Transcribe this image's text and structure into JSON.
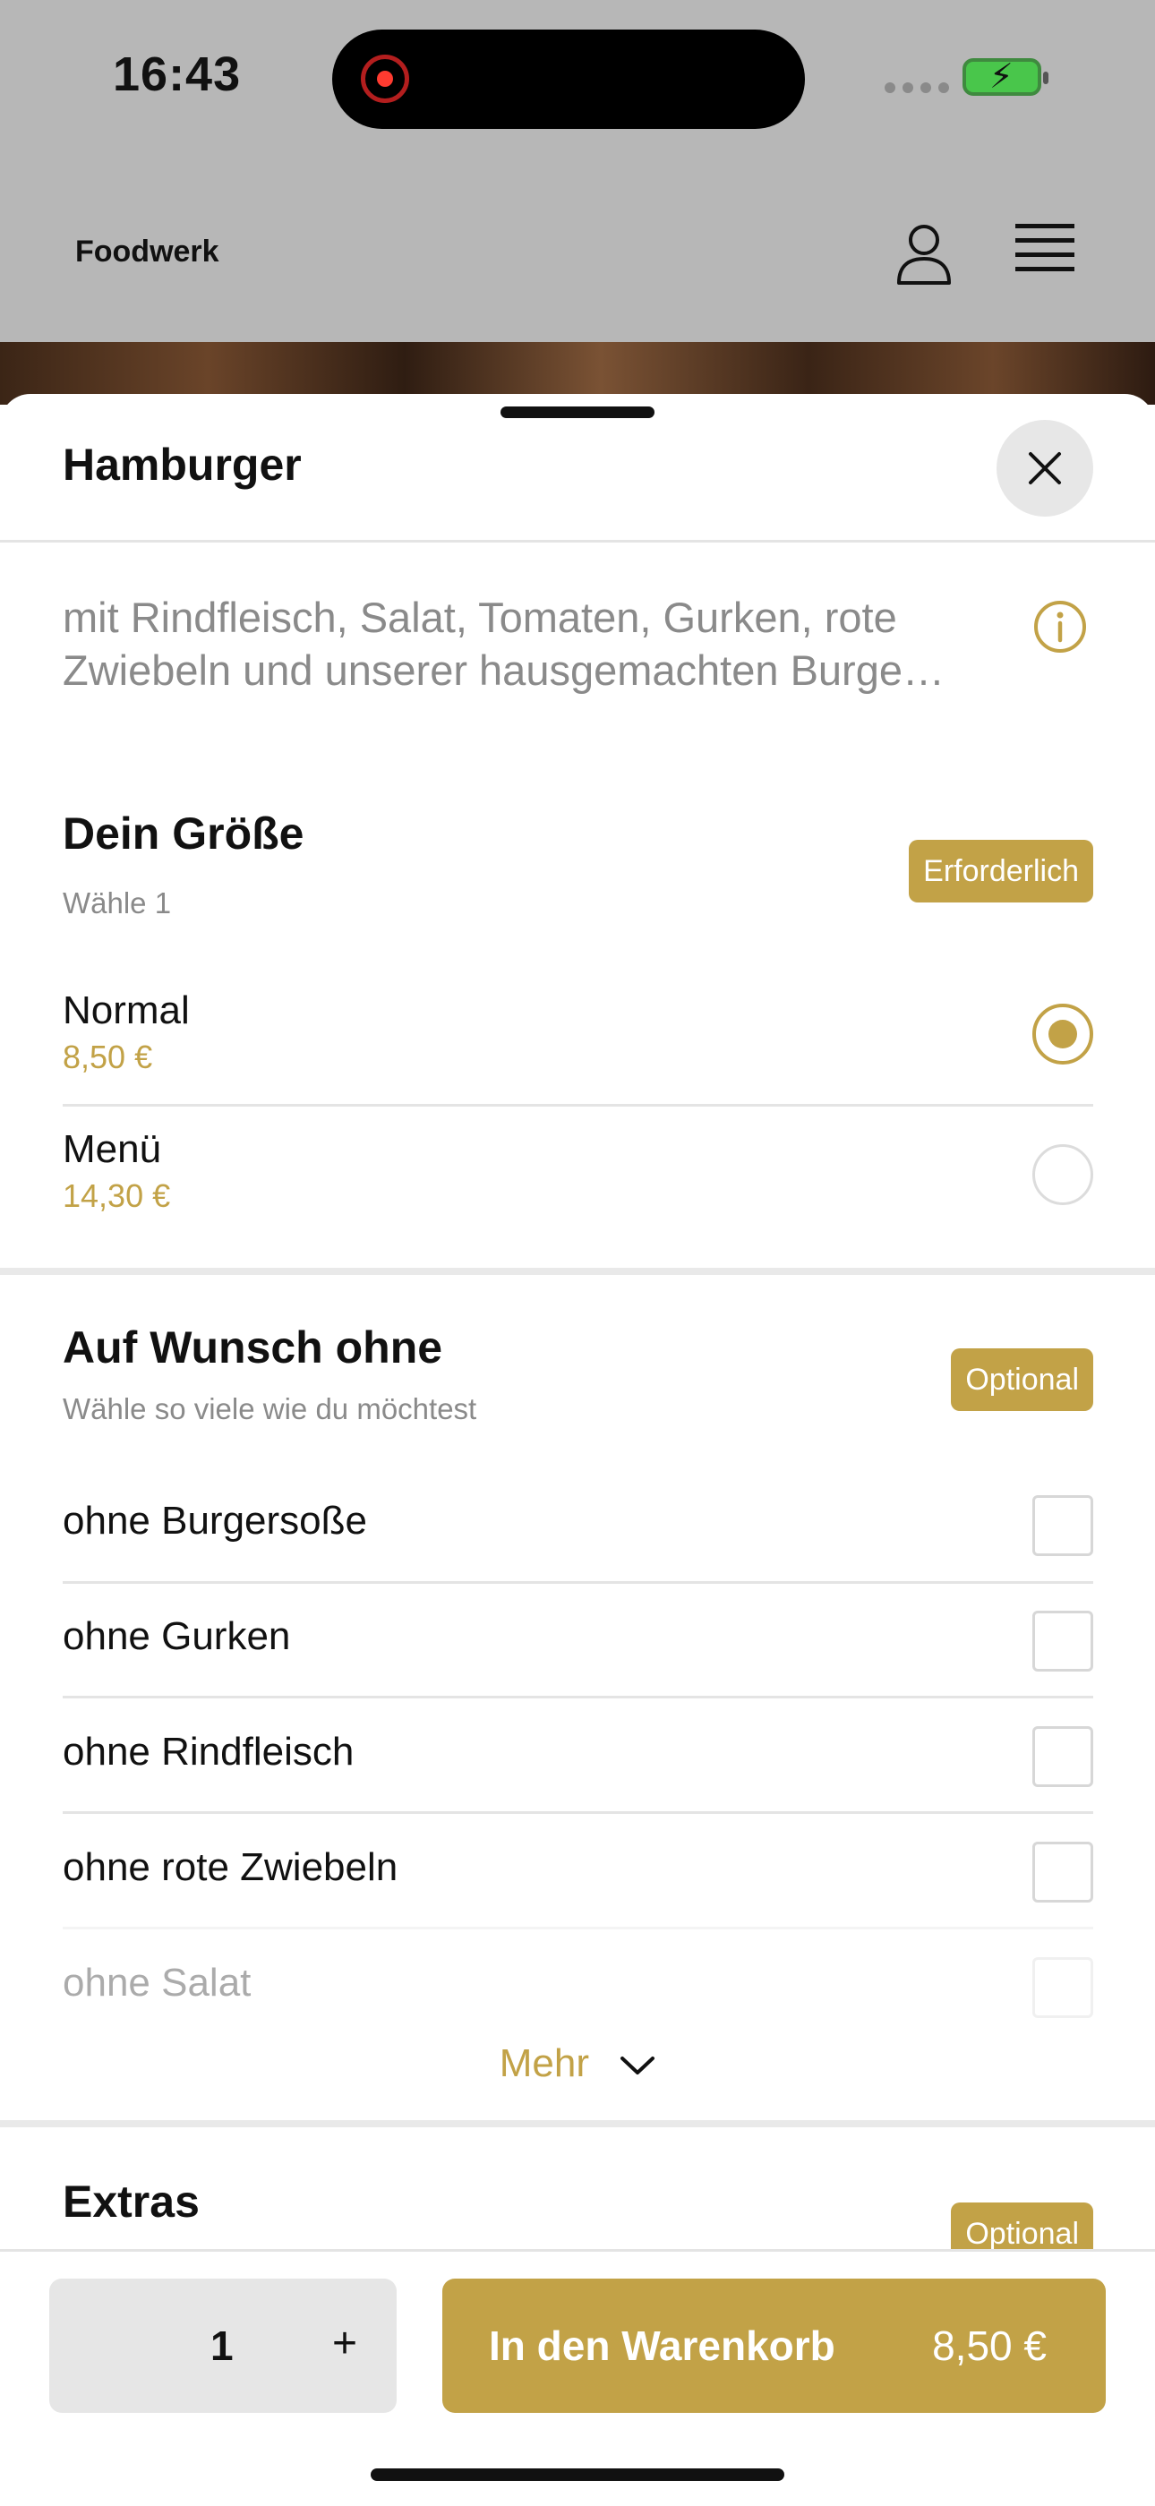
{
  "status_bar": {
    "time": "16:43"
  },
  "app_bar": {
    "brand": "Foodwerk"
  },
  "sheet": {
    "title": "Hamburger",
    "description": "mit Rindfleisch, Salat, Tomaten, Gurken, rote Zwiebeln und unserer hausgemachten Burge…"
  },
  "size_section": {
    "title": "Dein Größe",
    "subtitle": "Wähle 1",
    "badge": "Erforderlich",
    "options": [
      {
        "name": "Normal",
        "price": "8,50 €",
        "selected": true
      },
      {
        "name": "Menü",
        "price": "14,30 €",
        "selected": false
      }
    ]
  },
  "without_section": {
    "title": "Auf Wunsch ohne",
    "subtitle": "Wähle so viele wie du möchtest",
    "badge": "Optional",
    "options": [
      {
        "name": "ohne Burgersoße",
        "checked": false
      },
      {
        "name": "ohne Gurken",
        "checked": false
      },
      {
        "name": "ohne Rindfleisch",
        "checked": false
      },
      {
        "name": "ohne rote Zwiebeln",
        "checked": false
      },
      {
        "name": "ohne Salat",
        "checked": false
      }
    ],
    "more_label": "Mehr"
  },
  "extras_section": {
    "title": "Extras",
    "badge": "Optional"
  },
  "bottom_bar": {
    "quantity": "1",
    "plus": "+",
    "cart_label": "In den Warenkorb",
    "cart_price": "8,50 €"
  },
  "colors": {
    "accent": "#c2a247",
    "dim_background": "#b7b7b7"
  }
}
